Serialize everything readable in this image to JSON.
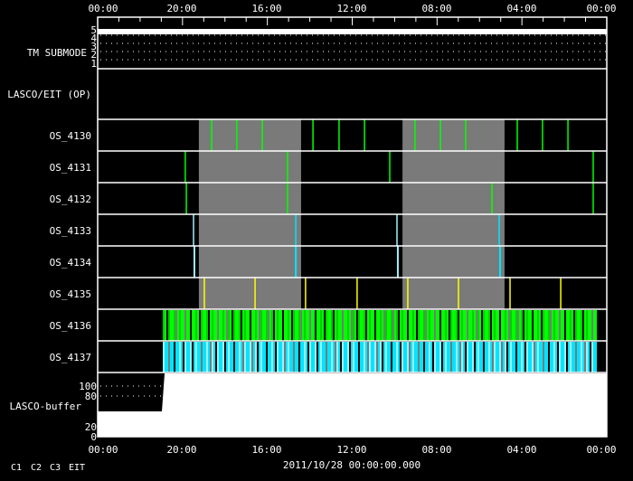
{
  "colors": {
    "background": "#000000",
    "frame": "#ffffff",
    "night_band": "#7a7a7a",
    "c1": "#ff0000",
    "c2": "#00ff00",
    "c3": "#00e5ff",
    "c3_light": "#a0f0ff",
    "eit": "#ffff00"
  },
  "axis": {
    "tick_labels": [
      "00:00",
      "20:00",
      "16:00",
      "12:00",
      "08:00",
      "04:00",
      "00:00"
    ],
    "span_hours": 24
  },
  "date_label": "2011/10/28 00:00:00.000",
  "legend": [
    {
      "label": "C1",
      "color": "#ff0000"
    },
    {
      "label": "C2",
      "color": "#00ff00"
    },
    {
      "label": "C3",
      "color": "#a0f0ff"
    },
    {
      "label": "EIT",
      "color": "#ffff00"
    }
  ],
  "tm_submode": {
    "label": "TM SUBMODE",
    "levels": [
      "5",
      "4",
      "3",
      "2",
      "1"
    ],
    "value": 5
  },
  "lasco_eit_op": {
    "label": "LASCO/EIT (OP)"
  },
  "gray_bands_hours": [
    [
      19.23,
      14.41
    ],
    [
      9.63,
      4.82
    ]
  ],
  "rows": [
    {
      "label": "OS_4130",
      "color": "#00ff00",
      "events": [
        18.63,
        17.44,
        16.24,
        13.85,
        12.62,
        11.42,
        9.04,
        7.84,
        6.65,
        4.22,
        3.03,
        1.83
      ]
    },
    {
      "label": "OS_4131",
      "color": "#00ff00",
      "events": [
        19.87,
        15.05,
        10.23,
        0.64
      ]
    },
    {
      "label": "OS_4132",
      "color": "#00ff00",
      "events": [
        19.82,
        15.05,
        5.41,
        0.64
      ]
    },
    {
      "label": "OS_4133",
      "color": "#00e5ff",
      "events": [
        19.48,
        14.66,
        9.89,
        5.07
      ]
    },
    {
      "label": "OS_4134",
      "color": "#00e5ff",
      "events": [
        19.44,
        14.66,
        9.85,
        5.03
      ]
    },
    {
      "label": "OS_4135",
      "color": "#ffff00",
      "events": [
        18.97,
        16.58,
        14.2,
        11.77,
        9.38,
        6.99,
        4.56,
        2.17
      ]
    },
    {
      "label": "OS_4136",
      "color": "#00ff00",
      "dense": [
        20.93,
        0.47
      ]
    },
    {
      "label": "OS_4137",
      "color": "#00e5ff",
      "dense": [
        20.93,
        0.47
      ]
    }
  ],
  "lasco_buffer": {
    "label": "LASCO-buffer",
    "ticks": [
      "100",
      "80",
      "20",
      "0"
    ],
    "level_before": 50,
    "level_after": "full",
    "change_hour": 20.93
  }
}
